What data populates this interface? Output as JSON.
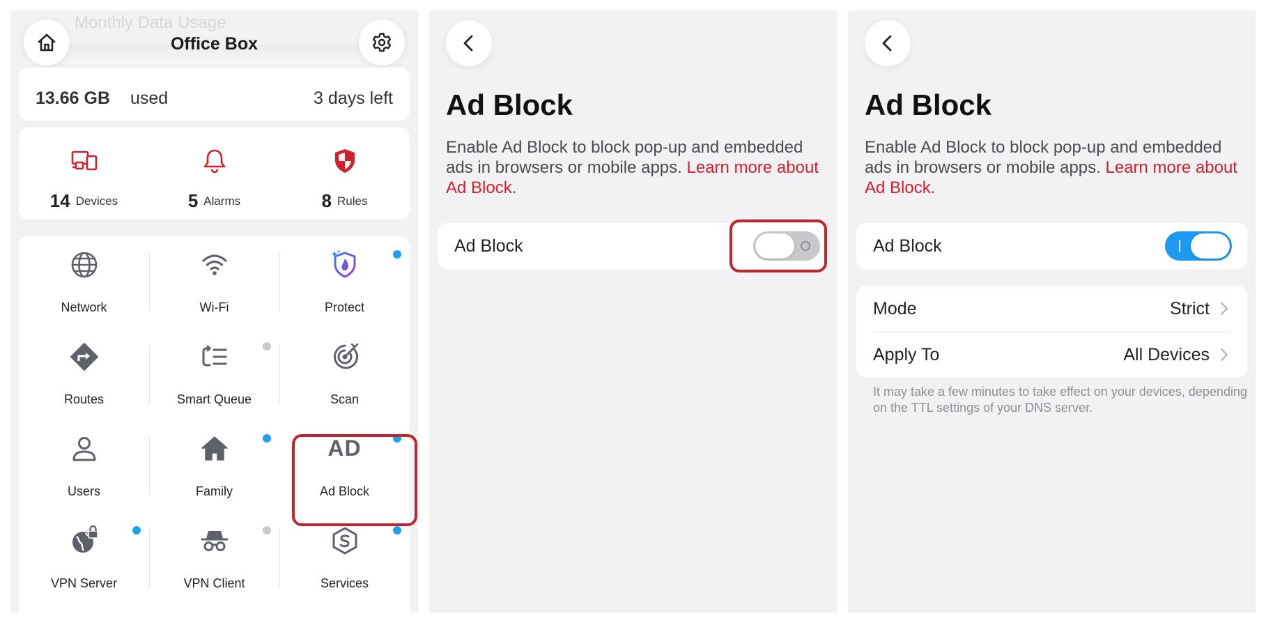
{
  "panel1": {
    "ghost_text": "Monthly Data Usage",
    "title": "Office Box",
    "usage_value": "13.66 GB",
    "usage_unit": "used",
    "days_left": "3 days left",
    "stats": [
      {
        "icon": "devices-icon",
        "value": "14",
        "label": "Devices"
      },
      {
        "icon": "bell-icon",
        "value": "5",
        "label": "Alarms"
      },
      {
        "icon": "shield-icon",
        "value": "8",
        "label": "Rules"
      }
    ],
    "tiles": [
      {
        "icon": "globe-icon",
        "label": "Network",
        "dot": ""
      },
      {
        "icon": "wifi-icon",
        "label": "Wi-Fi",
        "dot": ""
      },
      {
        "icon": "protect-icon",
        "label": "Protect",
        "dot": "blue"
      },
      {
        "icon": "routes-icon",
        "label": "Routes",
        "dot": ""
      },
      {
        "icon": "smart-queue-icon",
        "label": "Smart Queue",
        "dot": "gray"
      },
      {
        "icon": "scan-icon",
        "label": "Scan",
        "dot": ""
      },
      {
        "icon": "user-icon",
        "label": "Users",
        "dot": ""
      },
      {
        "icon": "house-icon",
        "label": "Family",
        "dot": "blue"
      },
      {
        "icon": "ad-icon",
        "label": "Ad Block",
        "icon_text": "AD",
        "dot": "blue"
      },
      {
        "icon": "vpn-server-icon",
        "label": "VPN Server",
        "dot": "blue"
      },
      {
        "icon": "vpn-client-icon",
        "label": "VPN Client",
        "dot": "gray"
      },
      {
        "icon": "services-icon",
        "label": "Services",
        "dot": "blue"
      }
    ]
  },
  "panel2": {
    "title": "Ad Block",
    "description": "Enable Ad Block to block pop-up and embedded ads in browsers or mobile apps.",
    "link_text": "Learn more about Ad Block.",
    "toggle_label": "Ad Block",
    "toggle_state": "off"
  },
  "panel3": {
    "title": "Ad Block",
    "description": "Enable Ad Block to block pop-up and embedded ads in browsers or mobile apps.",
    "link_text": "Learn more about Ad Block.",
    "toggle_label": "Ad Block",
    "toggle_state": "on",
    "mode_label": "Mode",
    "mode_value": "Strict",
    "apply_label": "Apply To",
    "apply_value": "All Devices",
    "note": "It may take a few minutes to take effect on your devices, depending on the TTL settings of your DNS server."
  },
  "colors": {
    "accent_red": "#d0202a",
    "toggle_on": "#1a9af0",
    "dot_blue": "#1f9ff0",
    "highlight": "#c0242c"
  }
}
